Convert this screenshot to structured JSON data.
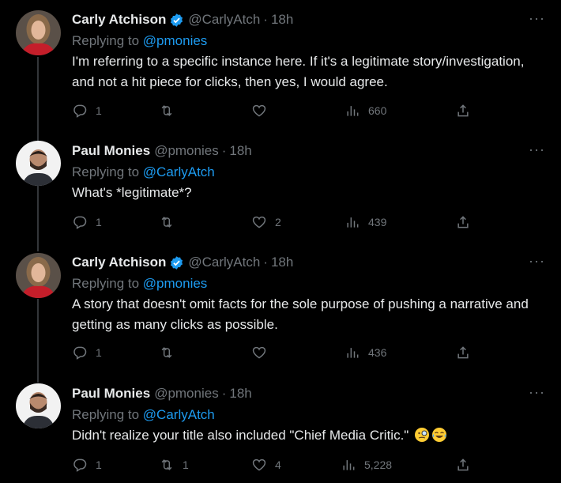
{
  "tweets": [
    {
      "name": "Carly Atchison",
      "handle": "@CarlyAtch",
      "time": "18h",
      "replying_prefix": "Replying to",
      "replying_to": "@pmonies",
      "text": "I'm referring to a specific instance here. If it's a legitimate story/investigation, and not a hit piece for clicks, then yes, I would agree.",
      "replies": "1",
      "retweets": "",
      "likes": "",
      "views": "660"
    },
    {
      "name": "Paul Monies",
      "handle": "@pmonies",
      "time": "18h",
      "replying_prefix": "Replying to",
      "replying_to": "@CarlyAtch",
      "text": "What's *legitimate*?",
      "replies": "1",
      "retweets": "",
      "likes": "2",
      "views": "439"
    },
    {
      "name": "Carly Atchison",
      "handle": "@CarlyAtch",
      "time": "18h",
      "replying_prefix": "Replying to",
      "replying_to": "@pmonies",
      "text": "A story that doesn't omit facts for the sole purpose of pushing a narrative and getting as many clicks as possible.",
      "replies": "1",
      "retweets": "",
      "likes": "",
      "views": "436"
    },
    {
      "name": "Paul Monies",
      "handle": "@pmonies",
      "time": "18h",
      "replying_prefix": "Replying to",
      "replying_to": "@CarlyAtch",
      "text": "Didn't realize your title also included \"Chief Media Critic.\"",
      "replies": "1",
      "retweets": "1",
      "likes": "4",
      "views": "5,228"
    }
  ],
  "separator": "·",
  "more_label": "···",
  "colors": {
    "background": "#000000",
    "text": "#e7e9ea",
    "muted": "#71767b",
    "link": "#1d9bf0",
    "verified": "#1d9bf0"
  },
  "icons": [
    "reply-icon",
    "retweet-icon",
    "like-icon",
    "views-icon",
    "share-icon",
    "verified-badge-icon",
    "monocle-face-emoji",
    "tears-of-joy-emoji"
  ]
}
